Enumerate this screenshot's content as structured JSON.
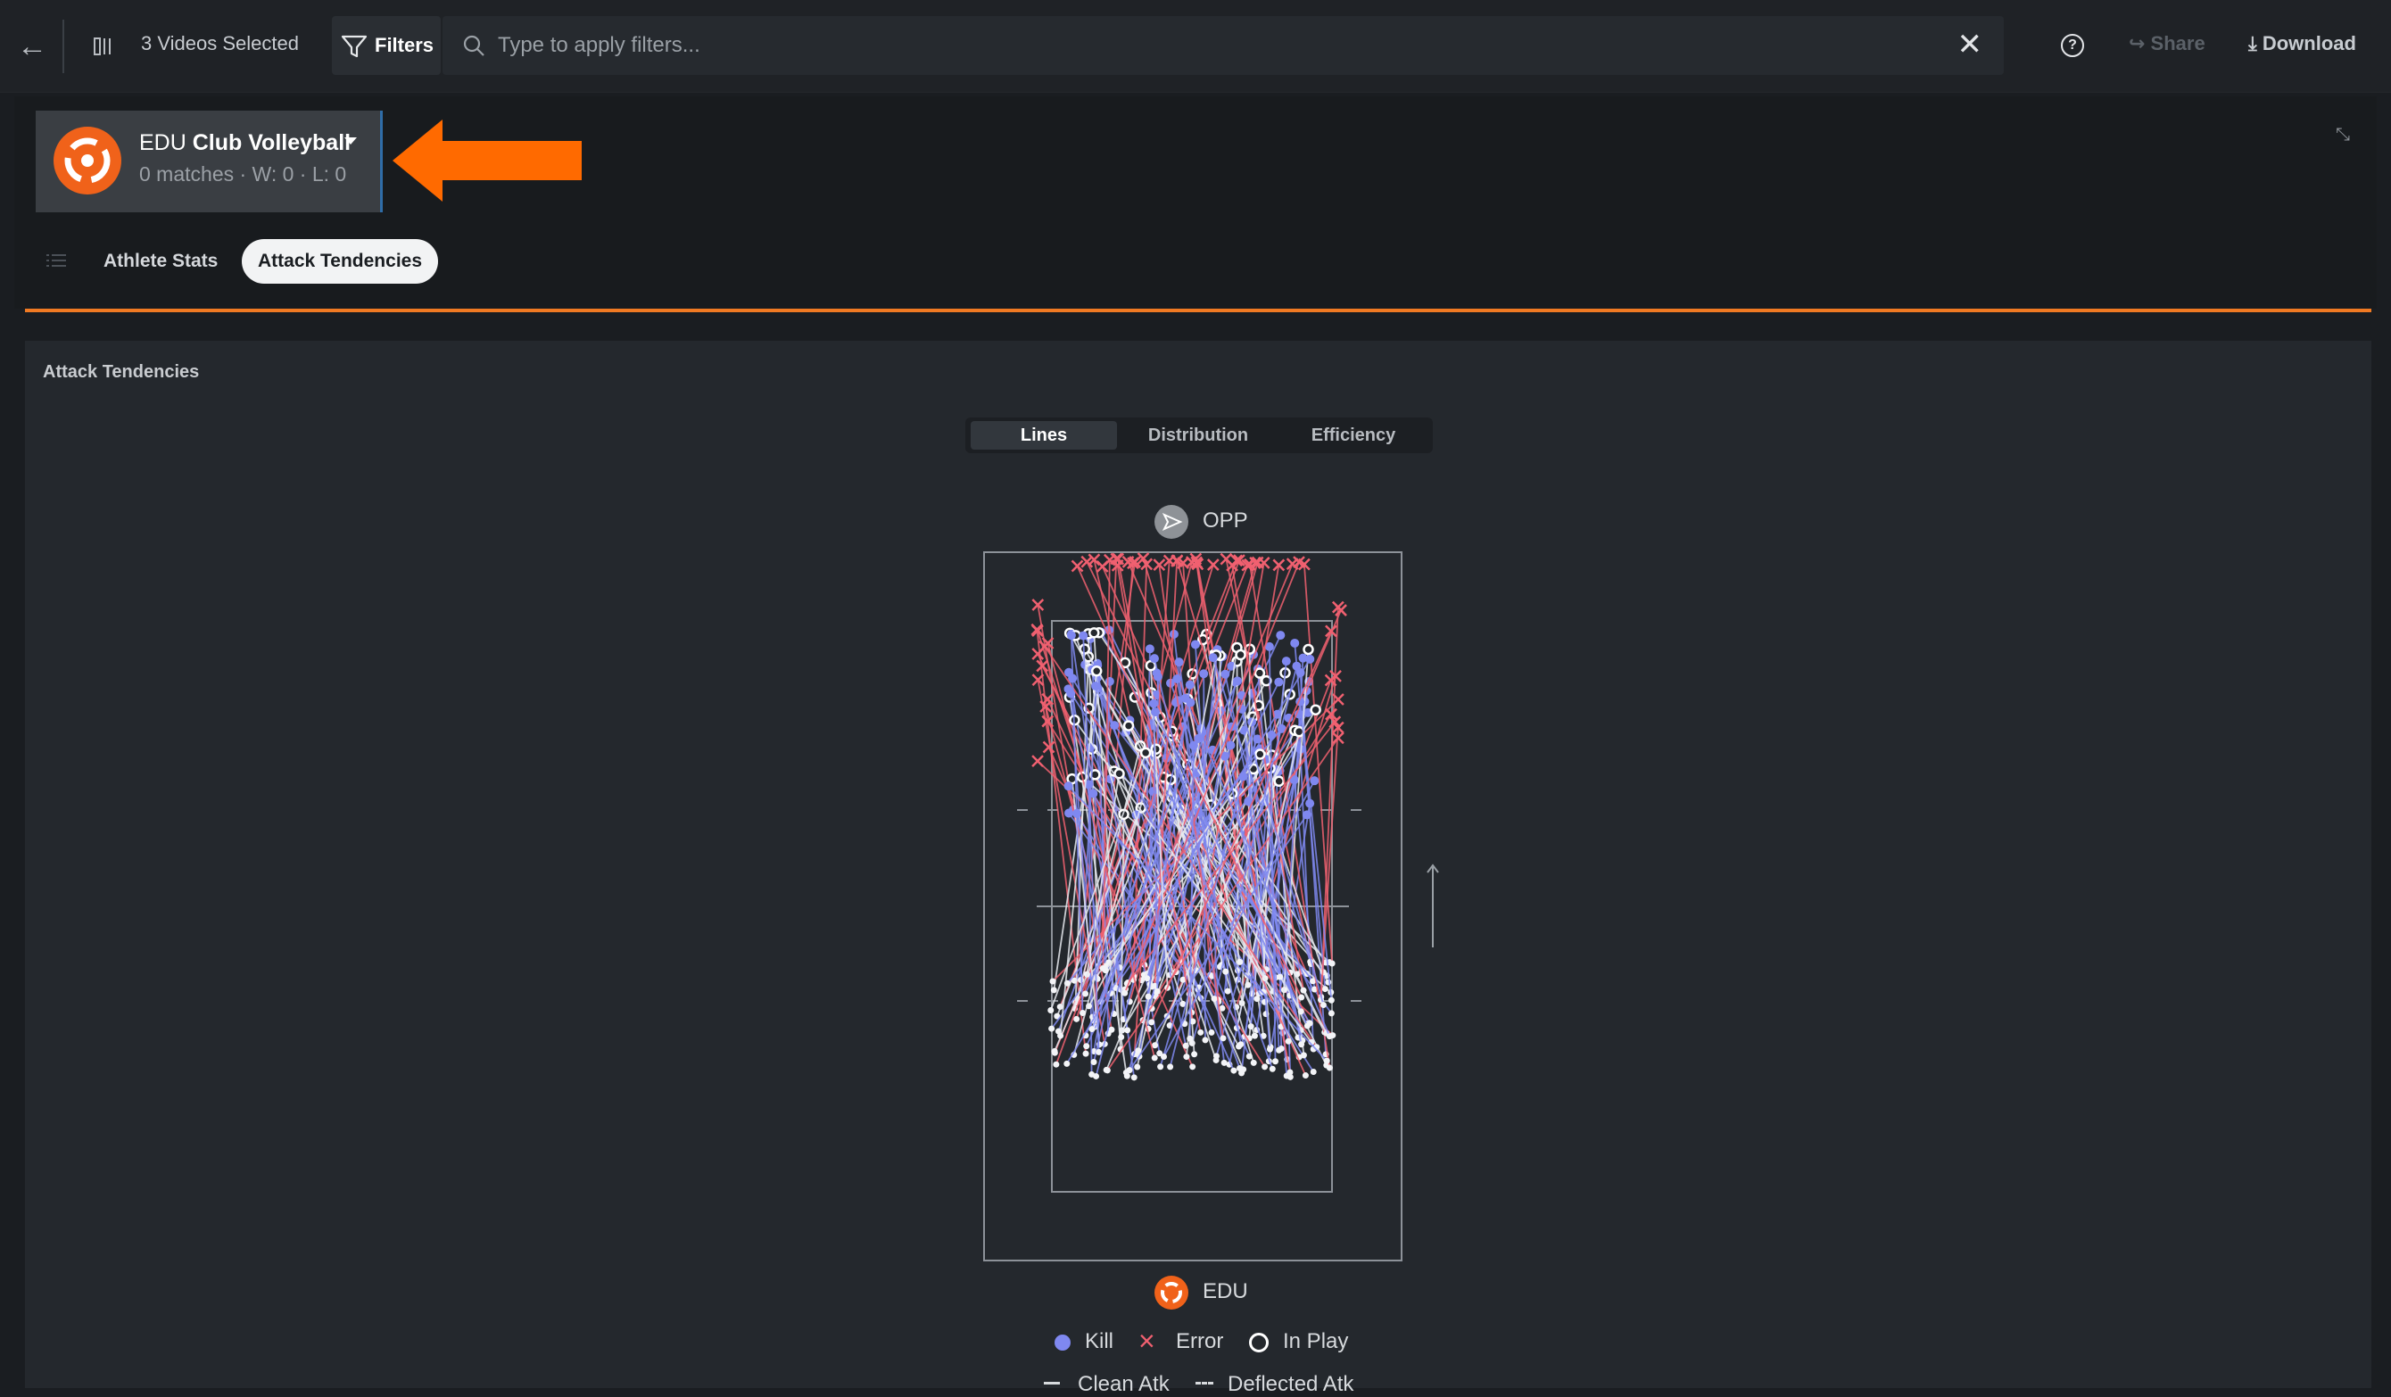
{
  "toolbar": {
    "videos_selected": "3 Videos Selected",
    "filters_label": "Filters",
    "search_placeholder": "Type to apply filters...",
    "share_label": "Share",
    "download_label": "Download",
    "help_glyph": "?",
    "clear_glyph": "✕",
    "icons": [
      "back-arrow-icon",
      "video-columns-icon",
      "filter-icon",
      "search-icon",
      "close-icon",
      "help-icon",
      "share-icon",
      "download-icon"
    ]
  },
  "team": {
    "prefix": "EDU",
    "name": "Club Volleyball",
    "record": "0 matches · W: 0 · L: 0",
    "logo_color": "#f0621a"
  },
  "tabs": [
    {
      "label": "Athlete Stats",
      "active": false
    },
    {
      "label": "Attack Tendencies",
      "active": true
    }
  ],
  "section": {
    "title": "Attack Tendencies",
    "view_modes": [
      {
        "label": "Lines",
        "active": true
      },
      {
        "label": "Distribution",
        "active": false
      },
      {
        "label": "Efficiency",
        "active": false
      }
    ]
  },
  "court": {
    "top_team": "OPP",
    "bottom_team": "EDU"
  },
  "legend": {
    "kill": "Kill",
    "error": "Error",
    "in_play": "In Play",
    "clean": "Clean Atk",
    "deflected": "Deflected Atk"
  },
  "colors": {
    "accent": "#f07a23",
    "kill": "#7f88f0",
    "error": "#f06070",
    "in_play": "#ffffff",
    "annotation_arrow": "#ff6a00"
  }
}
